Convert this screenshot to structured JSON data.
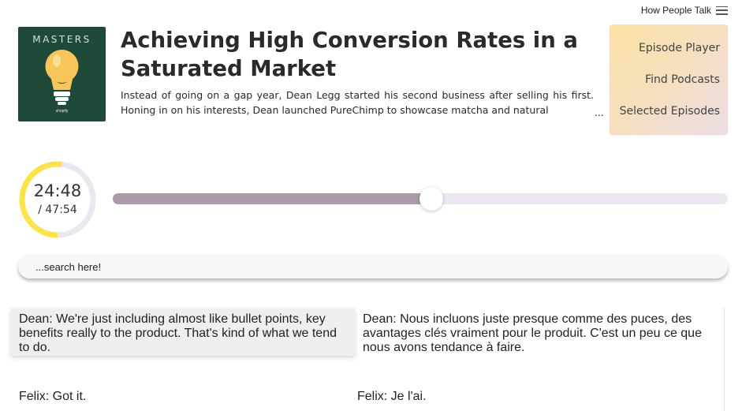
{
  "header": {
    "app_title": "How People Talk"
  },
  "cover": {
    "show_name": "MASTERS",
    "brand": "shopify"
  },
  "episode": {
    "title": "Achieving High Conversion Rates in a Saturated Market",
    "description": "Instead of going on a gap year, Dean Legg started his second business after selling his first. Honing in on his interests, Dean launched PureChimp to showcase matcha and natural",
    "ellipsis": "..."
  },
  "nav": {
    "items": [
      {
        "label": "Episode Player"
      },
      {
        "label": "Find Podcasts"
      },
      {
        "label": "Selected Episodes"
      }
    ]
  },
  "player": {
    "current_time": "24:48",
    "total_time": "/ 47:54",
    "progress": 0.5177,
    "colors": {
      "ring_track": "#ece6f0",
      "ring_progress": "#fde24a",
      "bar_fill": "#a89aa8",
      "bar_track": "#ece6f0"
    }
  },
  "search": {
    "placeholder": "...search here!",
    "value": ""
  },
  "transcript": [
    {
      "original": {
        "speaker": "Dean",
        "text": ": We're just including almost like bullet points, key benefits really to the product. That's kind of what we tend to do."
      },
      "translation": {
        "speaker": "Dean",
        "text": ": Nous incluons juste presque comme des puces, des avantages clés vraiment pour le produit. C'est un peu ce que nous avons tendance à faire."
      }
    },
    {
      "original": {
        "speaker": "Felix",
        "text": ": Got it."
      },
      "translation": {
        "speaker": "Felix",
        "text": ": Je l'ai."
      }
    }
  ]
}
